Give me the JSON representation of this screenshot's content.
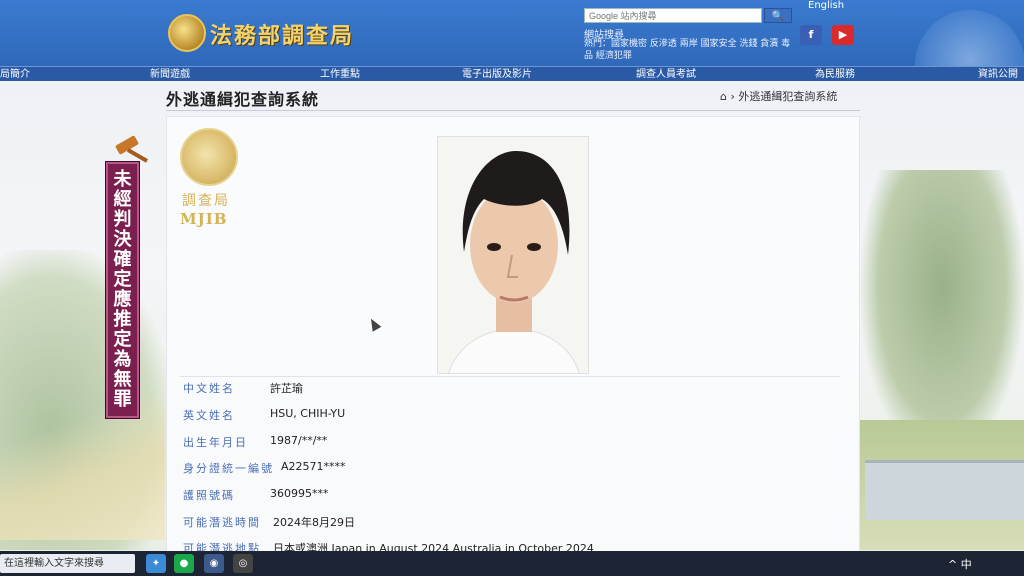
{
  "header": {
    "site_title": "法務部調查局",
    "search_placeholder": "Google 站內搜尋",
    "search_button_glyph": "🔍",
    "quick_title": "網站搜尋",
    "quick_links": "熱門：國家機密 反滲透 兩岸 國家安全 洗錢 貪瀆 毒品 經濟犯罪",
    "english_link": "English",
    "facebook_glyph": "f",
    "youtube_glyph": "▶"
  },
  "nav": {
    "items": [
      "局簡介",
      "新聞遊戲",
      "工作重點",
      "電子出版及影片",
      "調查人員考試",
      "為民服務",
      "資訊公開"
    ]
  },
  "page": {
    "heading": "外逃通緝犯查詢系統",
    "breadcrumb": "外逃通緝犯查詢系統",
    "emblem_name": "調查局",
    "emblem_abbr": "MJIB"
  },
  "record": {
    "rows": [
      {
        "label": "中文姓名",
        "value": "許芷瑜"
      },
      {
        "label": "英文姓名",
        "value": "HSU, CHIH-YU"
      },
      {
        "label": "出生年月日",
        "value": "1987/**/**"
      },
      {
        "label": "身分證統一編號",
        "value": "A22571****"
      },
      {
        "label": "護照號碼",
        "value": "360995***"
      },
      {
        "label": "可能潛逃時間",
        "value": "2024年8月29日"
      },
      {
        "label": "可能潛逃地點",
        "value": "日本或澳洲 Japan in August 2024 Australia in October 2024"
      }
    ]
  },
  "banner": {
    "text": "未經判決確定 應推定為無罪"
  },
  "taskbar": {
    "search_text": "在這裡輸入文字來搜尋",
    "tray_text": "^ 中"
  }
}
